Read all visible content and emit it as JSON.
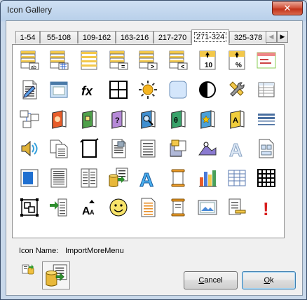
{
  "window": {
    "title": "Icon Gallery",
    "close_glyph": "✕"
  },
  "tabs": [
    {
      "label": "1-54",
      "active": false
    },
    {
      "label": "55-108",
      "active": false
    },
    {
      "label": "109-162",
      "active": false
    },
    {
      "label": "163-216",
      "active": false
    },
    {
      "label": "217-270",
      "active": false
    },
    {
      "label": "271-324",
      "active": true
    },
    {
      "label": "325-378",
      "active": false
    }
  ],
  "tab_scroll": {
    "left_glyph": "◀",
    "right_glyph": "▶"
  },
  "icons": [
    {
      "name": "table-ab-icon",
      "text": "ab"
    },
    {
      "name": "table-grid-icon",
      "text": ""
    },
    {
      "name": "table-rows-icon",
      "text": ""
    },
    {
      "name": "table-equals-icon",
      "text": "="
    },
    {
      "name": "table-greater-icon",
      "text": ">"
    },
    {
      "name": "table-less-icon",
      "text": "<"
    },
    {
      "name": "top-ten-icon",
      "text": "10"
    },
    {
      "name": "top-percent-icon",
      "text": "%"
    },
    {
      "name": "form-dialog-icon",
      "text": ""
    },
    {
      "name": "edit-document-icon",
      "text": ""
    },
    {
      "name": "window-frame-icon",
      "text": ""
    },
    {
      "name": "function-icon",
      "text": "fx"
    },
    {
      "name": "grid-four-icon",
      "text": ""
    },
    {
      "name": "sun-icon",
      "text": ""
    },
    {
      "name": "rounded-square-icon",
      "text": ""
    },
    {
      "name": "contrast-icon",
      "text": ""
    },
    {
      "name": "tools-icon",
      "text": ""
    },
    {
      "name": "table-small-icon",
      "text": ""
    },
    {
      "name": "database-diagram-icon",
      "text": ""
    },
    {
      "name": "book-face-icon",
      "text": ""
    },
    {
      "name": "book-green-icon",
      "text": ""
    },
    {
      "name": "book-help-icon",
      "text": "?"
    },
    {
      "name": "book-search-icon",
      "text": ""
    },
    {
      "name": "book-theta-icon",
      "text": "θ"
    },
    {
      "name": "book-star-icon",
      "text": ""
    },
    {
      "name": "book-letter-icon",
      "text": "A"
    },
    {
      "name": "lines-icon",
      "text": ""
    },
    {
      "name": "sound-icon",
      "text": ""
    },
    {
      "name": "copy-documents-icon",
      "text": ""
    },
    {
      "name": "page-corner-icon",
      "text": ""
    },
    {
      "name": "page-image-icon",
      "text": ""
    },
    {
      "name": "text-page-icon",
      "text": ""
    },
    {
      "name": "file-cabinet-icon",
      "text": ""
    },
    {
      "name": "chart-triangle-icon",
      "text": ""
    },
    {
      "name": "wordart-outline-icon",
      "text": "A"
    },
    {
      "name": "document-layout-icon",
      "text": ""
    },
    {
      "name": "blue-square-icon",
      "text": ""
    },
    {
      "name": "report-page-icon",
      "text": ""
    },
    {
      "name": "report-columns-icon",
      "text": ""
    },
    {
      "name": "import-more-menu-icon",
      "text": ""
    },
    {
      "name": "wordart-blue-icon",
      "text": "A"
    },
    {
      "name": "scroll-icon",
      "text": ""
    },
    {
      "name": "bar-chart-icon",
      "text": ""
    },
    {
      "name": "table-grid-blue-icon",
      "text": ""
    },
    {
      "name": "table-grid-dark-icon",
      "text": ""
    },
    {
      "name": "group-objects-icon",
      "text": ""
    },
    {
      "name": "import-arrow-icon",
      "text": ""
    },
    {
      "name": "text-size-icon",
      "text": "A"
    },
    {
      "name": "smiley-icon",
      "text": ""
    },
    {
      "name": "document-orange-icon",
      "text": ""
    },
    {
      "name": "scroll-orange-icon",
      "text": ""
    },
    {
      "name": "picture-frame-icon",
      "text": ""
    },
    {
      "name": "document-minus-icon",
      "text": ""
    },
    {
      "name": "exclamation-icon",
      "text": "!"
    }
  ],
  "details": {
    "icon_name_label": "Icon Name:",
    "icon_name_value": "ImportMoreMenu"
  },
  "buttons": {
    "cancel_label": "Cancel",
    "cancel_accel": "C",
    "cancel_rest": "ancel",
    "ok_label": "Ok",
    "ok_accel": "O",
    "ok_rest": "k"
  }
}
